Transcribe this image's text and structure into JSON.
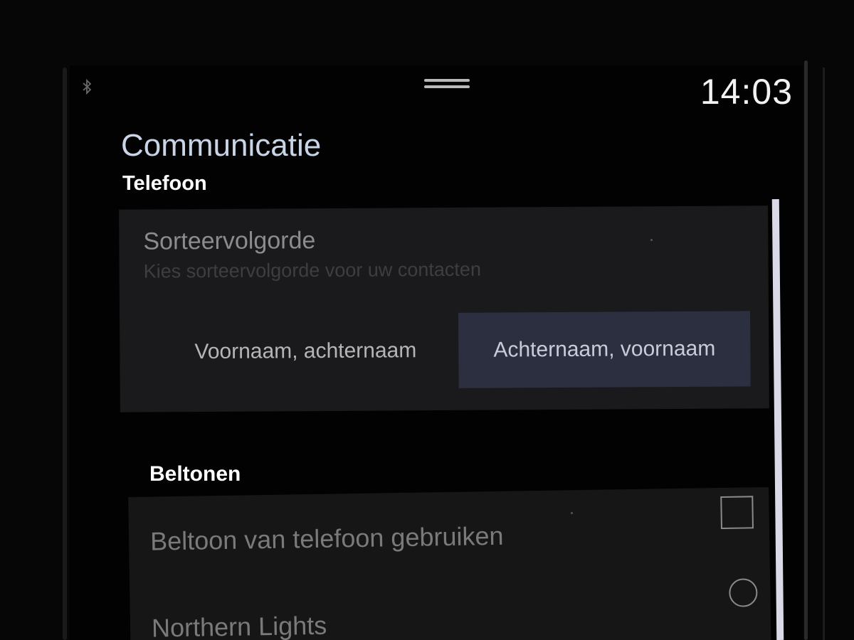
{
  "status_bar": {
    "bluetooth_icon": "bluetooth-icon",
    "handle_icon": "pull-down-handle-icon",
    "clock": "14:03"
  },
  "header": {
    "title": "Communicatie",
    "section": "Telefoon"
  },
  "sort_order": {
    "title": "Sorteervolgorde",
    "subtitle": "Kies sorteervolgorde voor uw contacten",
    "options": [
      "Voornaam, achternaam",
      "Achternaam, voornaam"
    ],
    "selected_index": 1
  },
  "ringtones": {
    "title": "Beltonen",
    "items": [
      {
        "label": "Beltoon van telefoon gebruiken",
        "control": "checkbox",
        "checked": false
      },
      {
        "label": "Northern Lights",
        "control": "radio",
        "selected": false
      }
    ]
  },
  "colors": {
    "selected_option_bg": "#2c2f40",
    "title_color": "#c9d4e6",
    "scrollbar": "#d9d9e8"
  }
}
